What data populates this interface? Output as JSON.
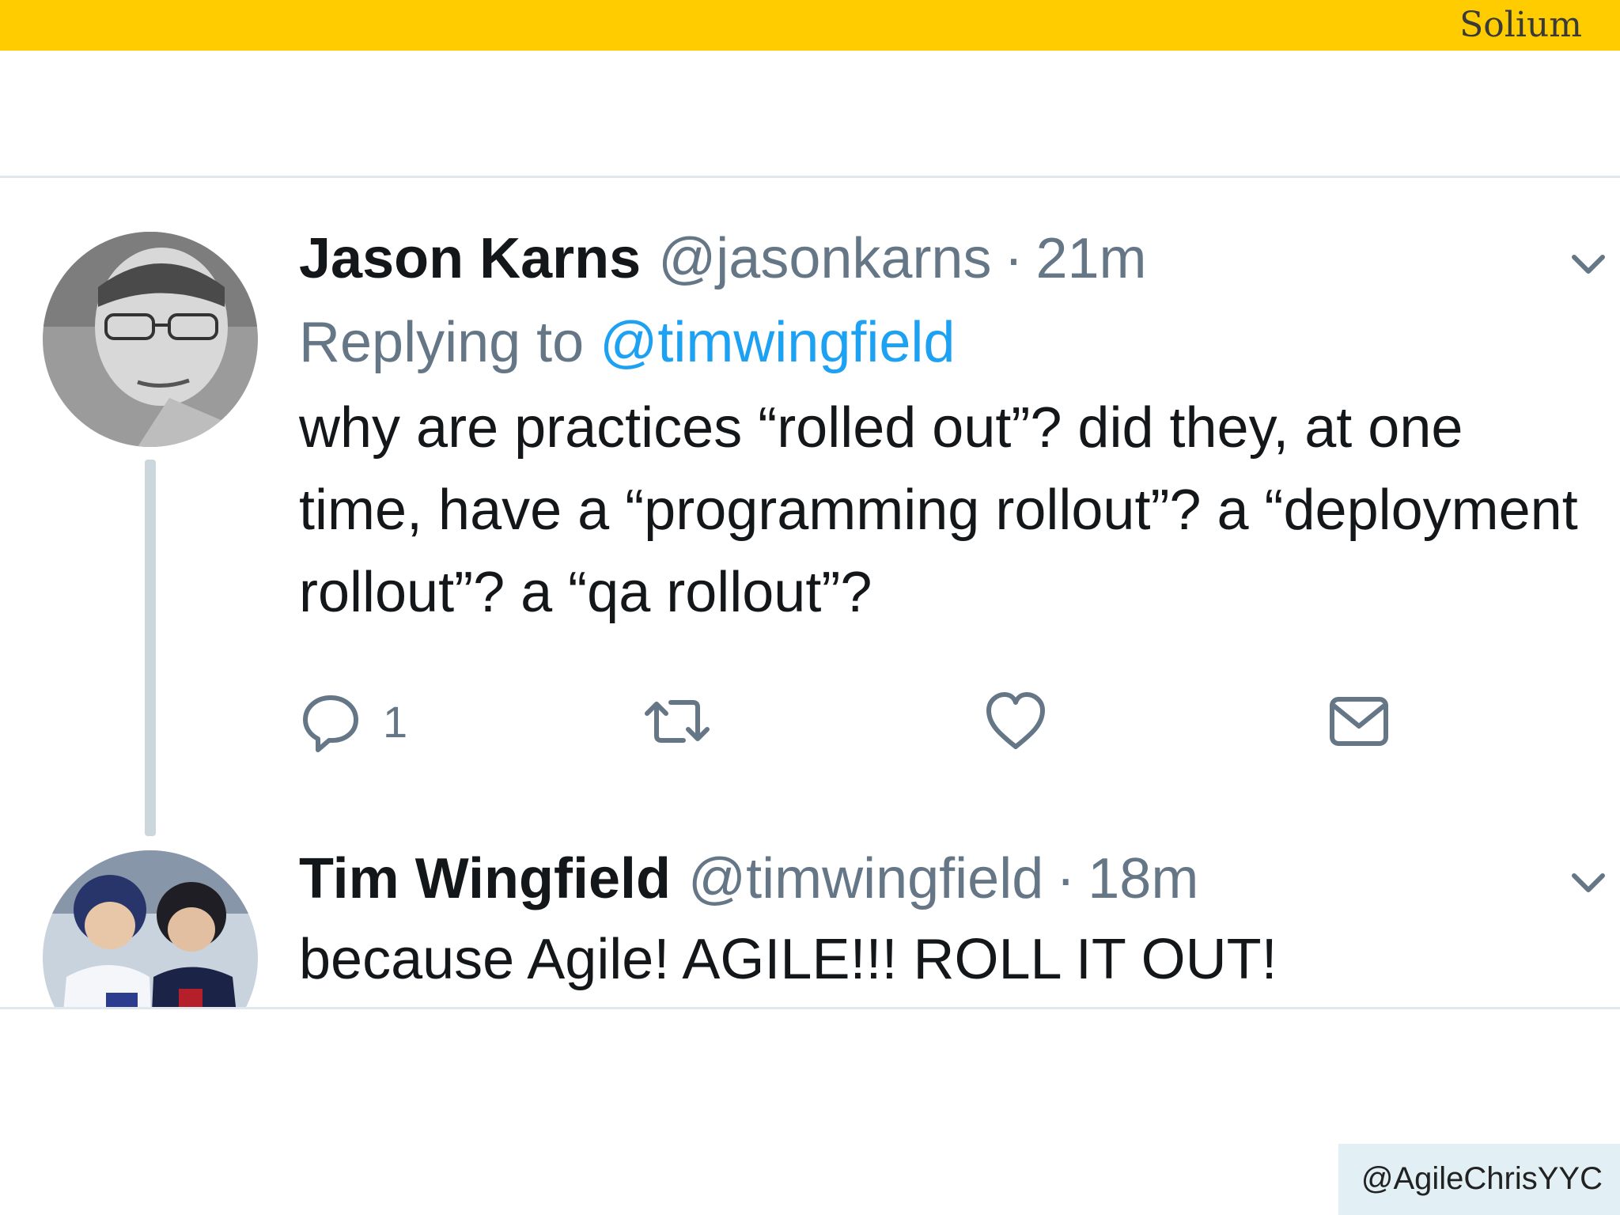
{
  "slide": {
    "brand": "Solium",
    "credit": "@AgileChrisYYC"
  },
  "tweets": [
    {
      "name": "Jason Karns",
      "handle": "@jasonkarns",
      "separator": "·",
      "time": "21m",
      "reply_prefix": "Replying to",
      "reply_handle": "@timwingfield",
      "text": "why are practices “rolled out”? did they, at one time, have a “programming rollout”? a “deployment rollout”? a “qa rollout”?",
      "reply_count": "1"
    },
    {
      "name": "Tim Wingfield",
      "handle": "@timwingfield",
      "separator": "·",
      "time": "18m",
      "text": "because Agile! AGILE!!! ROLL IT OUT!"
    }
  ],
  "icons": {
    "reply": "reply-icon",
    "retweet": "retweet-icon",
    "like": "heart-icon",
    "dm": "envelope-icon",
    "menu": "chevron-down-icon"
  },
  "colors": {
    "top_bar": "#ffcc00",
    "link": "#1da1f2",
    "secondary": "#657786",
    "thread_line": "#ccd6dd",
    "credit_bg": "#e2f0f5"
  }
}
